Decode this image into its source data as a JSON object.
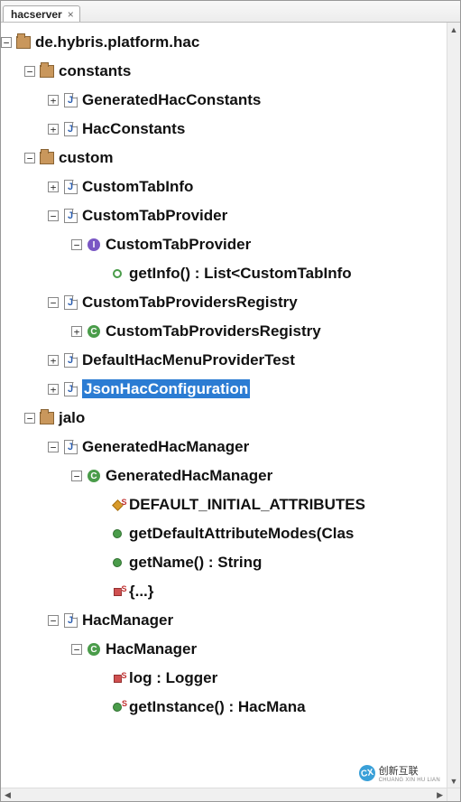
{
  "tab": {
    "title": "hacserver",
    "close": "×"
  },
  "scroll": {
    "up": "▲",
    "down": "▼",
    "left": "◀",
    "right": "▶"
  },
  "watermark": {
    "text": "创新互联",
    "sub": "CHUANG XIN HU LIAN",
    "badge": "CX"
  },
  "tree": {
    "root": {
      "label": "de.hybris.platform.hac",
      "children": {
        "constants": {
          "label": "constants",
          "items": [
            {
              "label": "GeneratedHacConstants"
            },
            {
              "label": "HacConstants"
            }
          ]
        },
        "custom": {
          "label": "custom",
          "items": [
            {
              "label": "CustomTabInfo"
            },
            {
              "label": "CustomTabProvider",
              "iface": {
                "label": "CustomTabProvider",
                "methods": [
                  {
                    "label": "getInfo() : List<CustomTabInfo"
                  }
                ]
              }
            },
            {
              "label": "CustomTabProvidersRegistry",
              "cls": {
                "label": "CustomTabProvidersRegistry"
              }
            },
            {
              "label": "DefaultHacMenuProviderTest"
            },
            {
              "label": "JsonHacConfiguration",
              "selected": true
            }
          ]
        },
        "jalo": {
          "label": "jalo",
          "items": [
            {
              "label": "GeneratedHacManager",
              "cls": {
                "label": "GeneratedHacManager",
                "members": [
                  {
                    "kind": "sfield",
                    "label": "DEFAULT_INITIAL_ATTRIBUTES"
                  },
                  {
                    "kind": "method",
                    "label": "getDefaultAttributeModes(Clas"
                  },
                  {
                    "kind": "method",
                    "label": "getName() : String"
                  },
                  {
                    "kind": "sblock",
                    "label": "{...}"
                  }
                ]
              }
            },
            {
              "label": "HacManager",
              "cls": {
                "label": "HacManager",
                "members": [
                  {
                    "kind": "spriv",
                    "label": "log : Logger"
                  },
                  {
                    "kind": "smethod",
                    "label": "getInstance() : HacMana"
                  }
                ]
              }
            }
          ]
        }
      }
    }
  }
}
